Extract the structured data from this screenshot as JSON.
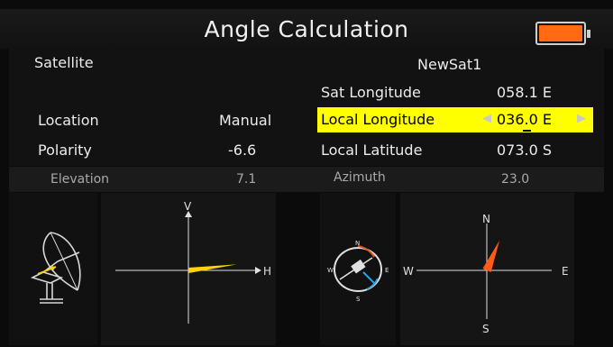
{
  "header": {
    "title": "Angle Calculation",
    "battery": {
      "level": 1.0,
      "color": "#ff6a12"
    }
  },
  "left": {
    "satellite_label": "Satellite",
    "location_label": "Location",
    "location_value": "Manual",
    "polarity_label": "Polarity",
    "polarity_value": "-6.6"
  },
  "right": {
    "satellite_name": "NewSat1",
    "sat_longitude_label": "Sat Longitude",
    "sat_longitude_value": "058.1 E",
    "local_longitude_label": "Local Longitude",
    "local_longitude_value": "036.0 E",
    "local_latitude_label": "Local Latitude",
    "local_latitude_value": "073.0 S",
    "highlight_color": "#ffff00"
  },
  "status": {
    "elevation_label": "Elevation",
    "elevation_value": "7.1",
    "azimuth_label": "Azimuth",
    "azimuth_value": "23.0"
  },
  "elevation_chart": {
    "v_label": "V",
    "h_label": "H",
    "angle_deg": 7.1,
    "needle_color": "#ffd400"
  },
  "azimuth_chart": {
    "n_label": "N",
    "s_label": "S",
    "w_label": "W",
    "e_label": "E",
    "angle_deg": 23.0,
    "needle_color": "#ff5a1a"
  }
}
